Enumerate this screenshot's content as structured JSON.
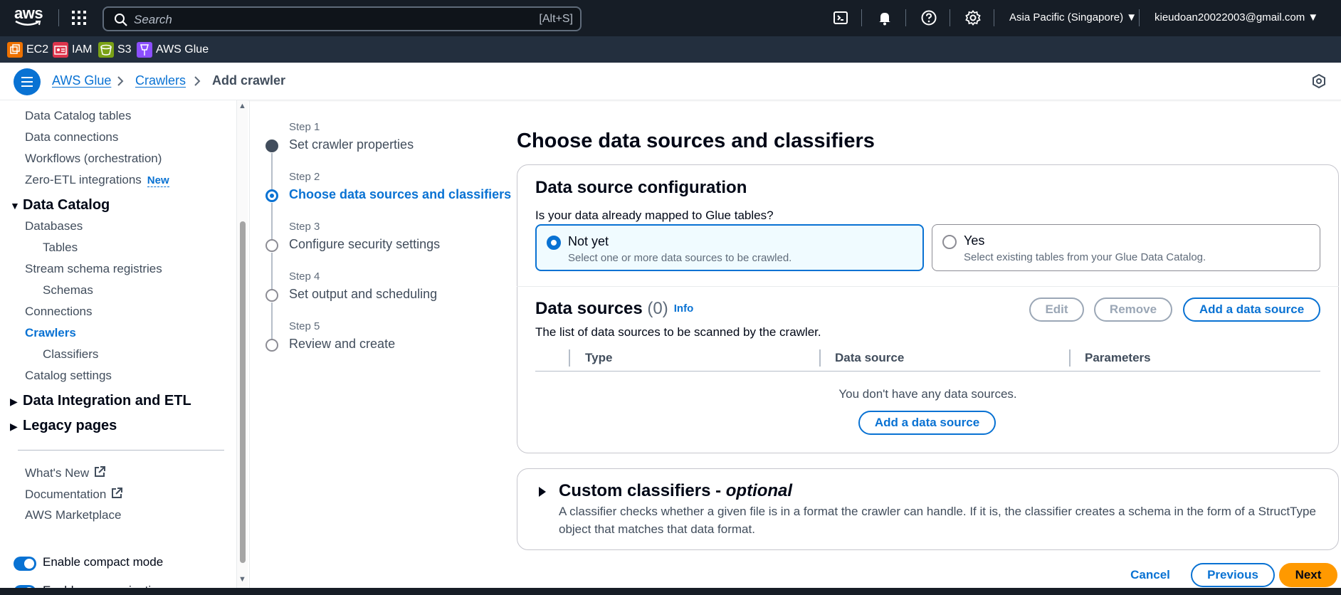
{
  "topnav": {
    "logo": "aws",
    "search_placeholder": "Search",
    "search_shortcut": "[Alt+S]",
    "icons": [
      "cloudshell-icon",
      "bell-icon",
      "help-icon",
      "gear-icon"
    ],
    "region": "Asia Pacific (Singapore) ▼",
    "account": "kieudoan20022003@gmail.com ▼"
  },
  "favorites": [
    {
      "label": "EC2",
      "color": "#ed7100"
    },
    {
      "label": "IAM",
      "color": "#dd344c"
    },
    {
      "label": "S3",
      "color": "#7aa116"
    },
    {
      "label": "AWS Glue",
      "color": "#8c4fff"
    }
  ],
  "breadcrumb": {
    "items": [
      "AWS Glue",
      "Crawlers"
    ],
    "current": "Add crawler"
  },
  "sidebar": {
    "items": [
      {
        "label": "Data Catalog tables",
        "level": "top"
      },
      {
        "label": "Data connections",
        "level": "top"
      },
      {
        "label": "Workflows (orchestration)",
        "level": "top"
      },
      {
        "label": "Zero-ETL integrations",
        "level": "top",
        "badge": "New"
      }
    ],
    "section_data_catalog": "Data Catalog",
    "catalog_items": [
      {
        "label": "Databases"
      },
      {
        "label": "Tables"
      },
      {
        "label": "Stream schema registries"
      },
      {
        "label": "Schemas"
      },
      {
        "label": "Connections"
      },
      {
        "label": "Crawlers"
      },
      {
        "label": "Classifiers"
      },
      {
        "label": "Catalog settings"
      }
    ],
    "section_integration": "Data Integration and ETL",
    "section_legacy": "Legacy pages",
    "footer_links": [
      "What's New",
      "Documentation",
      "AWS Marketplace"
    ],
    "toggles": [
      "Enable compact mode",
      "Enable new navigation"
    ]
  },
  "stepper": {
    "steps": [
      {
        "label": "Step 1",
        "title": "Set crawler properties",
        "state": "done"
      },
      {
        "label": "Step 2",
        "title": "Choose data sources and classifiers",
        "state": "active"
      },
      {
        "label": "Step 3",
        "title": "Configure security settings",
        "state": "pending"
      },
      {
        "label": "Step 4",
        "title": "Set output and scheduling",
        "state": "pending"
      },
      {
        "label": "Step 5",
        "title": "Review and create",
        "state": "pending"
      }
    ]
  },
  "main": {
    "page_title": "Choose data sources and classifiers",
    "config": {
      "title": "Data source configuration",
      "question": "Is your data already mapped to Glue tables?",
      "options": [
        {
          "title": "Not yet",
          "desc": "Select one or more data sources to be crawled.",
          "selected": true
        },
        {
          "title": "Yes",
          "desc": "Select existing tables from your Glue Data Catalog.",
          "selected": false
        }
      ]
    },
    "data_sources": {
      "title": "Data sources",
      "count": "(0)",
      "info": "Info",
      "desc": "The list of data sources to be scanned by the crawler.",
      "edit": "Edit",
      "remove": "Remove",
      "add": "Add a data source",
      "columns": [
        "Type",
        "Data source",
        "Parameters"
      ],
      "empty": "You don't have any data sources.",
      "empty_add": "Add a data source"
    },
    "classifiers": {
      "title": "Custom classifiers - ",
      "title_em": "optional",
      "desc": "A classifier checks whether a given file is in a format the crawler can handle. If it is, the classifier creates a schema in the form of a StructType object that matches that data format."
    },
    "actions": {
      "cancel": "Cancel",
      "previous": "Previous",
      "next": "Next"
    }
  }
}
